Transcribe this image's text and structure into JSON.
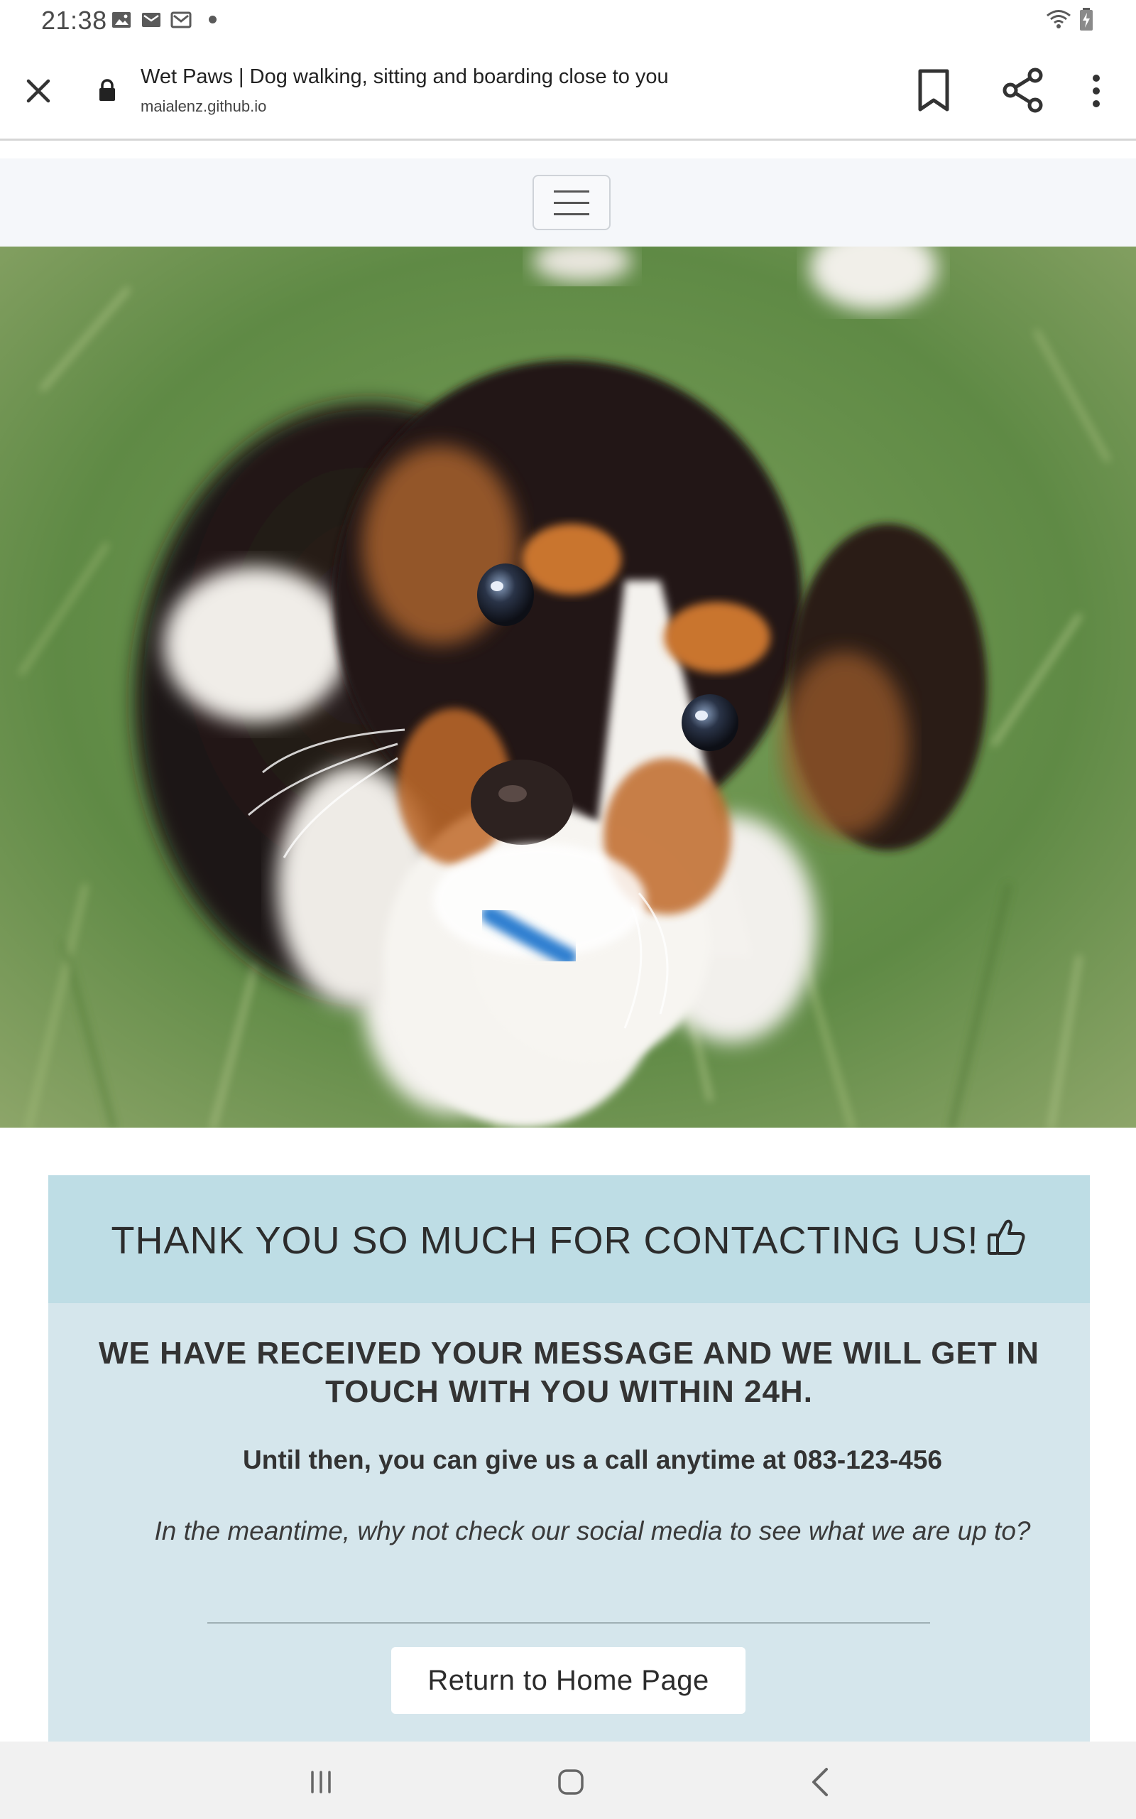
{
  "status_bar": {
    "time": "21:38",
    "left_icons": [
      "gallery-icon",
      "email-icon",
      "gmail-icon"
    ],
    "right_icons": [
      "wifi-icon",
      "battery-charging-icon"
    ]
  },
  "browser": {
    "page_title": "Wet Paws | Dog walking, sitting and boarding close to you",
    "url": "maialenz.github.io",
    "icons": [
      "close-icon",
      "lock-icon",
      "bookmark-icon",
      "share-icon",
      "more-vert-icon"
    ]
  },
  "site_nav": {
    "toggle_icon": "hamburger-icon"
  },
  "hero": {
    "subject": "puppy-in-grass-photo"
  },
  "message": {
    "heading": "THANK YOU SO MUCH FOR CONTACTING US!",
    "heading_icon": "thumbs-up-icon",
    "subheading": "WE HAVE RECEIVED YOUR MESSAGE AND WE WILL GET IN TOUCH WITH YOU WITHIN 24H.",
    "call_text": "Until then, you can give us a call anytime at 083-123-456",
    "social_text": "In the meantime, why not check our social media to see what we are up to?",
    "return_button": "Return to Home Page"
  },
  "colors": {
    "card_header": "#bedde5",
    "card_body": "#d5e6ec",
    "navbar_bg": "#f5f7fa"
  },
  "system_nav": {
    "icons": [
      "recents-icon",
      "home-icon",
      "back-icon"
    ]
  }
}
